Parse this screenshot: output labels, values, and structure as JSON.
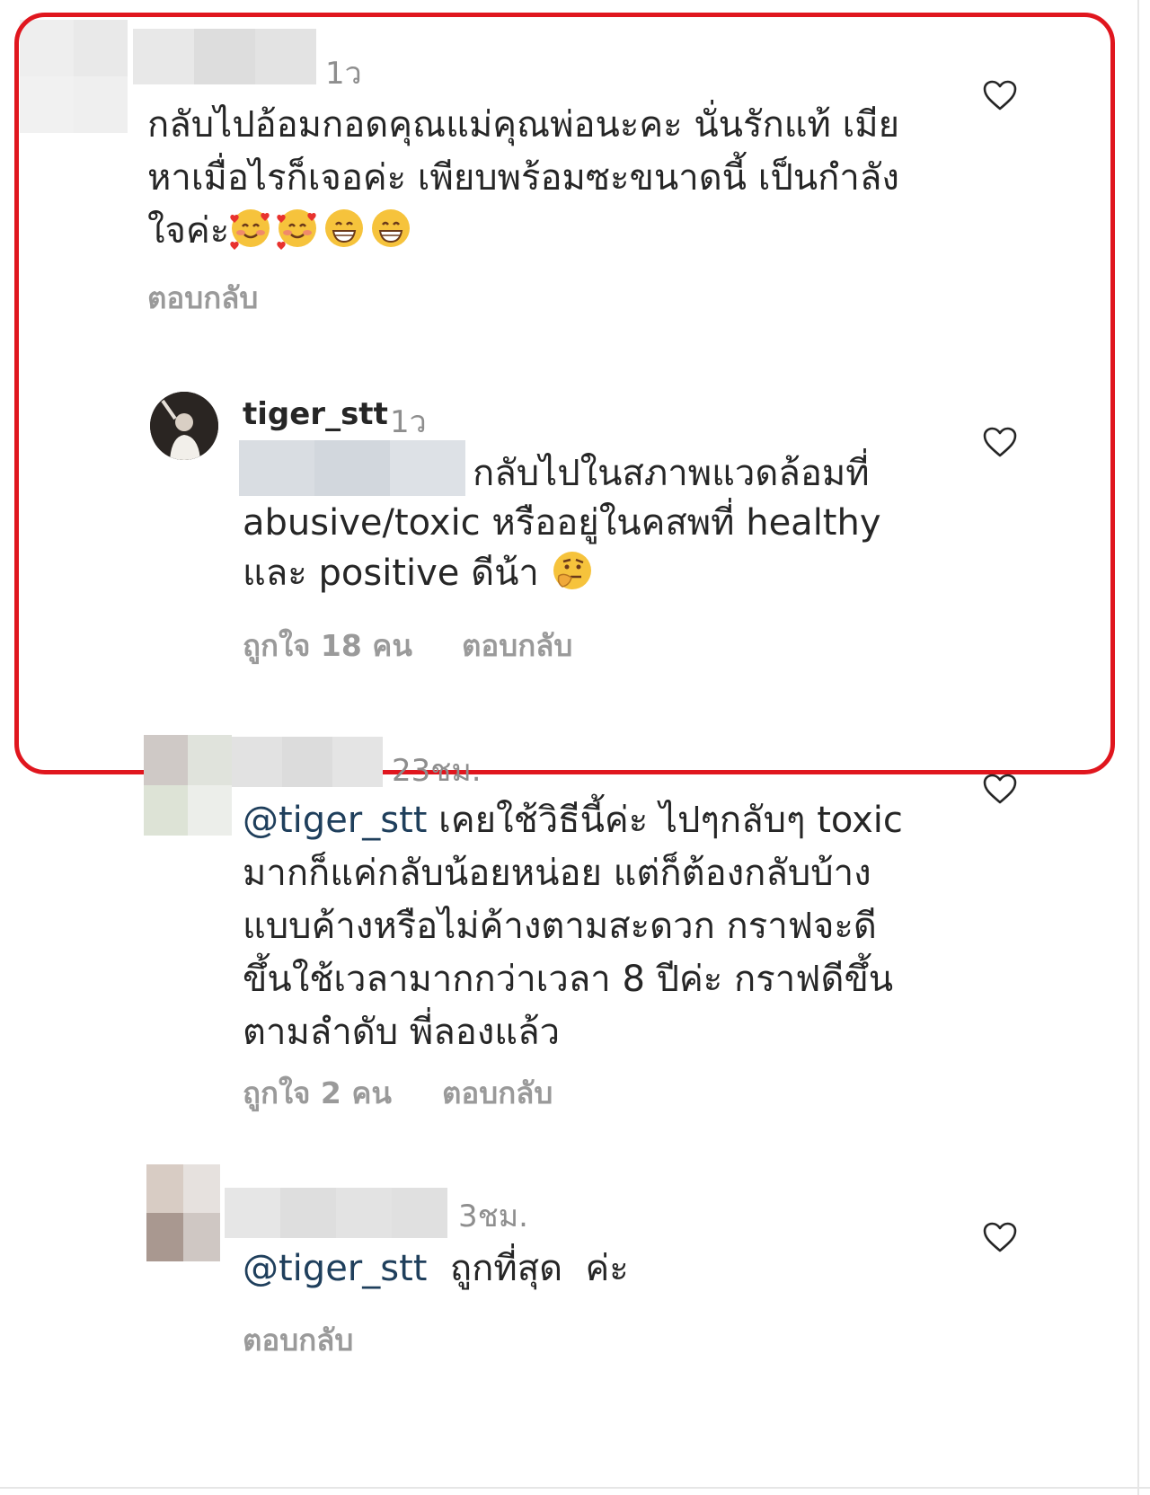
{
  "comments": [
    {
      "time": "1ว",
      "text": "กลับไปอ้อมกอดคุณแม่คุณพ่อนะคะ นั่นรักแท้ เมีย\nหาเมื่อไรก็เจอค่ะ เพียบพร้อมซะขนาดนี้ เป็นกำลัง\nใจค่ะ",
      "emojis": [
        "smiling-face-with-hearts",
        "smiling-face-with-hearts",
        "grinning-face",
        "grinning-face"
      ],
      "reply_label": "ตอบกลับ"
    },
    {
      "username": "tiger_stt",
      "time": "1ว",
      "line1": "กลับไปในสภาพแวดล้อมที่",
      "line2": "abusive/toxic หรืออยู่ในคสพที่ healthy",
      "line3": "และ positive ดีน้า",
      "emoji": "thinking-face",
      "likes_label": "ถูกใจ 18 คน",
      "reply_label": "ตอบกลับ"
    },
    {
      "time": "23ชม.",
      "mention": "@tiger_stt",
      "text": " เคยใช้วิธีนี้ค่ะ ไปๆกลับๆ toxic\nมากก็แค่กลับน้อยหน่อย แต่ก็ต้องกลับบ้าง\nแบบค้างหรือไม่ค้างตามสะดวก กราฟจะดี\nขึ้นใช้เวลามากกว่าเวลา 8 ปีค่ะ กราฟดีขึ้น\nตามลำดับ พี่ลองแล้ว",
      "likes_label": "ถูกใจ 2 คน",
      "reply_label": "ตอบกลับ"
    },
    {
      "time": "3ชม.",
      "mention": "@tiger_stt",
      "text": "  ถูกที่สุด  ค่ะ",
      "reply_label": "ตอบกลับ"
    }
  ],
  "colors": {
    "highlight_border": "#e0161e",
    "mention": "#1f3f5c",
    "secondary_text": "#8e8e8e",
    "primary_text": "#262626"
  },
  "icons": [
    "heart-outline-icon",
    "avatar-photo"
  ]
}
